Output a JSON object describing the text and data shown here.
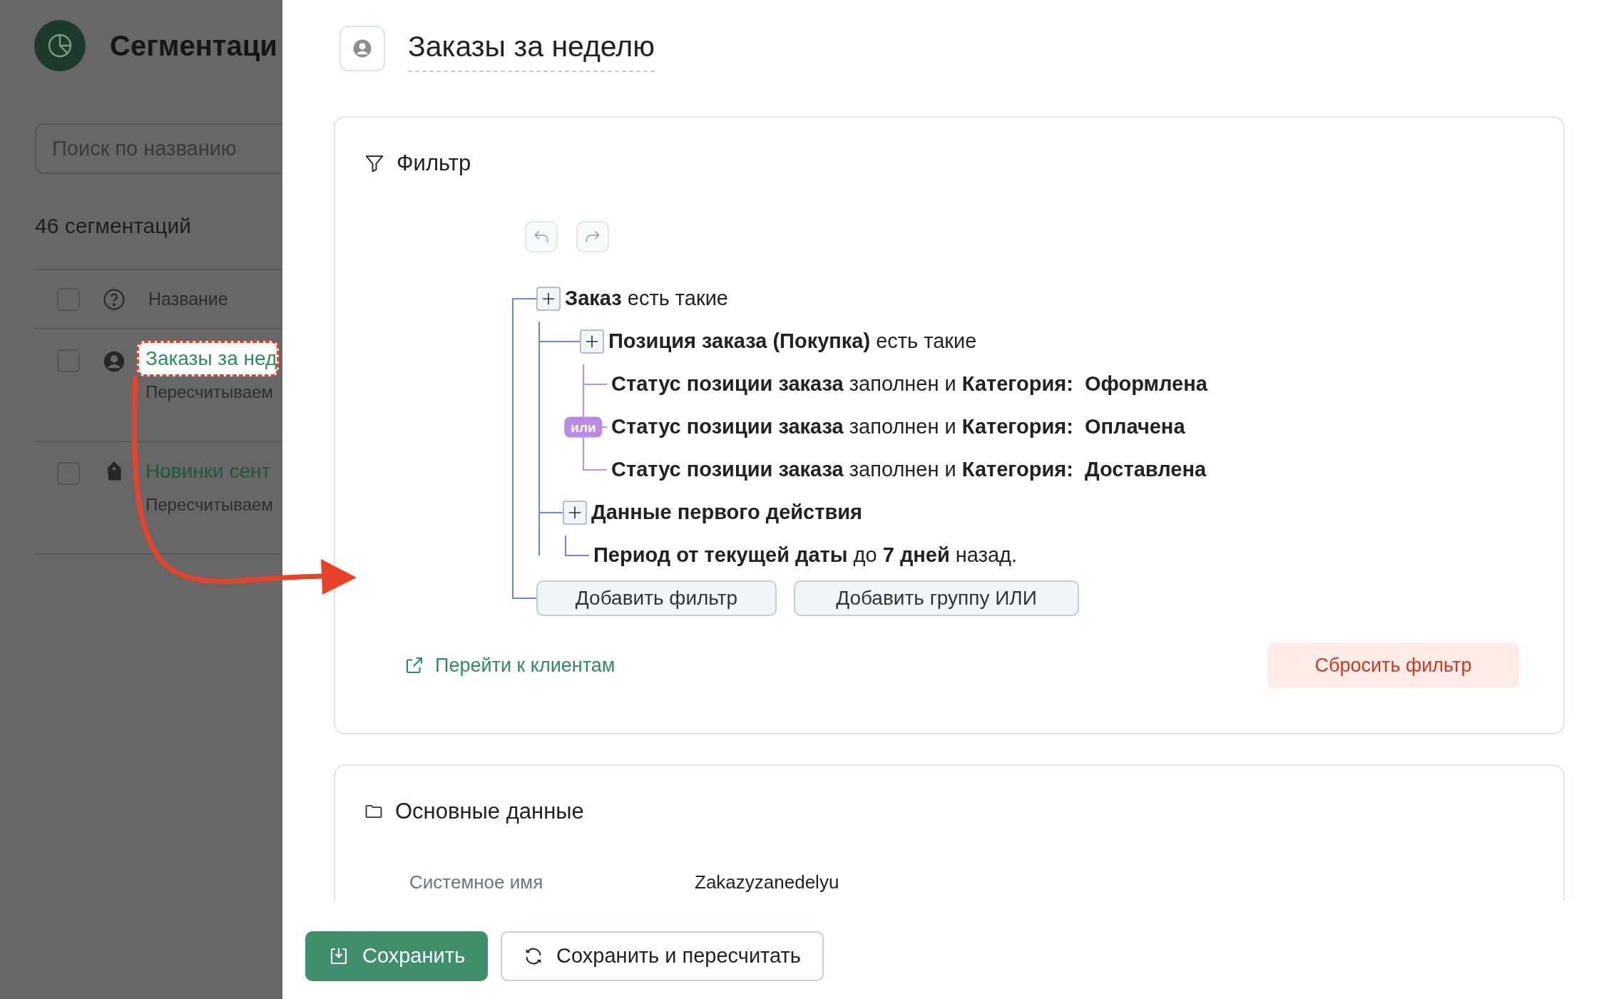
{
  "sidebar": {
    "title": "Сегментаци",
    "search": {
      "placeholder": "Поиск по названию"
    },
    "count": "46 сегментаций",
    "table": {
      "columns": [
        "Название"
      ],
      "select_all": {
        "checked": false
      },
      "rows": [
        {
          "name": "Заказы за нед",
          "subtitle": "Пересчитываем",
          "kind": "person",
          "highlighted": true,
          "checked": false
        },
        {
          "name": "Новинки сент",
          "subtitle": "Пересчитываем",
          "kind": "tag",
          "highlighted": false,
          "checked": false
        }
      ]
    }
  },
  "header": {
    "title": "Заказы за неделю"
  },
  "filter": {
    "title": "Фильтр",
    "tree": {
      "label": "**Заказ** есть такие",
      "children": [
        {
          "label": "**Позиция заказа (Покупка)** есть такие",
          "badge": "или",
          "children": [
            {
              "label": "**Статус позиции заказа** заполнен и **Категория:**  **Оформлена**"
            },
            {
              "label": "**Статус позиции заказа** заполнен и **Категория:**  **Оплачена**"
            },
            {
              "label": "**Статус позиции заказа** заполнен и **Категория:**  **Доставлена**"
            }
          ]
        },
        {
          "label": "**Данные первого действия**",
          "children": [
            {
              "label": "**Период от текущей даты** до **7 дней** назад."
            }
          ]
        }
      ]
    },
    "actions": [
      "Добавить фильтр",
      "Добавить группу ИЛИ"
    ],
    "link": "Перейти к клиентам",
    "reset": "Сбросить фильтр"
  },
  "main_data": {
    "title": "Основные данные",
    "fields": [
      {
        "label": "Системное имя",
        "value": "Zakazyzanedelyu"
      }
    ]
  },
  "footer": {
    "buttons": [
      {
        "kind": "primary",
        "label": "Сохранить"
      },
      {
        "kind": "secondary",
        "label": "Сохранить и пересчитать"
      }
    ]
  }
}
